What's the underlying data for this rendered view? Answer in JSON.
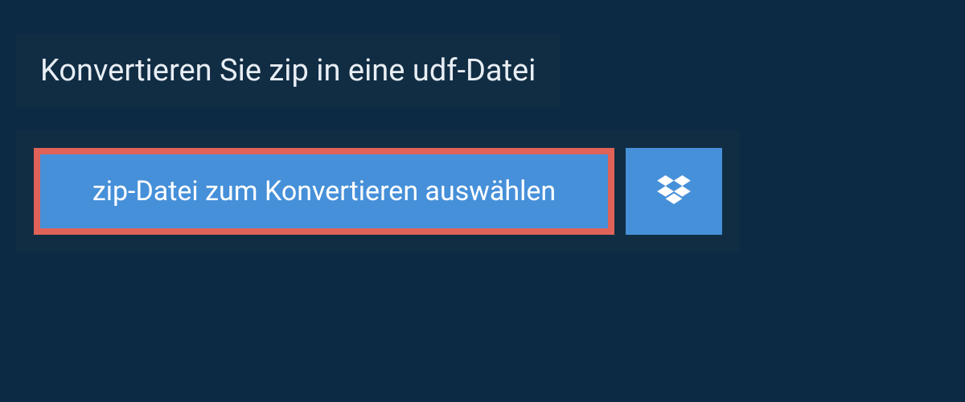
{
  "header": {
    "title": "Konvertieren Sie zip in eine udf-Datei"
  },
  "upload": {
    "select_button_label": "zip-Datei zum Konvertieren auswählen"
  }
}
